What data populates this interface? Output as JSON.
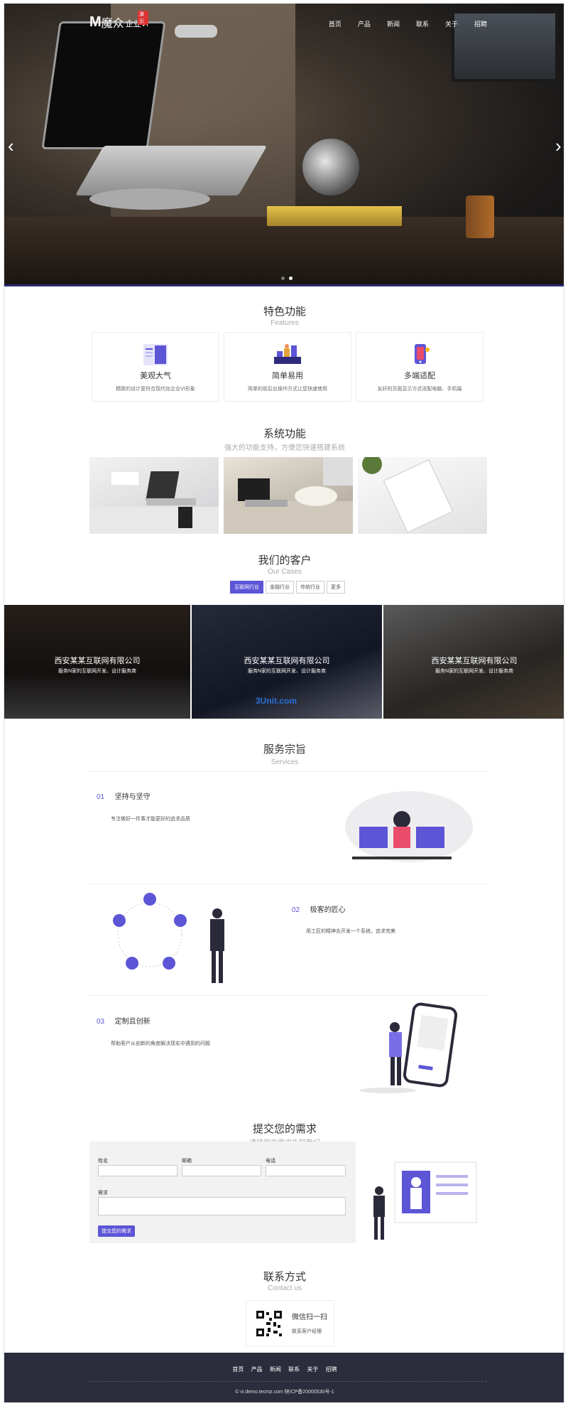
{
  "header": {
    "logo_mark": "M",
    "logo_text": "魔众",
    "logo_sub": "企业VI",
    "logo_badge": "演示",
    "nav": [
      "首页",
      "产品",
      "新闻",
      "联系",
      "关于",
      "招聘"
    ]
  },
  "features": {
    "title": "特色功能",
    "subtitle": "Features",
    "items": [
      {
        "title": "美观大气",
        "desc": "精致的设计更符合现代化企业VI形象"
      },
      {
        "title": "简单易用",
        "desc": "简单的前后台操作方式让您快速使用"
      },
      {
        "title": "多端适配",
        "desc": "友好的页面显示方式适配电脑、手机端"
      }
    ]
  },
  "system": {
    "title": "系统功能",
    "subtitle": "强大的功能支持，方便您快速搭建系统"
  },
  "clients": {
    "title": "我们的客户",
    "subtitle": "Our Cases",
    "tabs": [
      "互联网行业",
      "金融行业",
      "传统行业",
      "更多"
    ],
    "cases": [
      {
        "title": "西安某某互联网有限公司",
        "desc": "服务N家的互联网开发、设计服务商"
      },
      {
        "title": "西安某某互联网有限公司",
        "desc": "服务N家的互联网开发、设计服务商"
      },
      {
        "title": "西安某某互联网有限公司",
        "desc": "服务N家的互联网开发、设计服务商"
      }
    ],
    "watermark": "3Unit.com"
  },
  "services": {
    "title": "服务宗旨",
    "subtitle": "Services",
    "items": [
      {
        "num": "01",
        "title": "坚持与坚守",
        "desc": "专注做好一件事才能更好的追求品质"
      },
      {
        "num": "02",
        "title": "极客的匠心",
        "desc": "用工匠的精神去开发一个系统，追求完美"
      },
      {
        "num": "03",
        "title": "定制且创新",
        "desc": "帮助客户从创新的角度解决现实中遇到的问题"
      }
    ]
  },
  "request": {
    "title": "提交您的需求",
    "subtitle": "请将您的需求告知我们",
    "name_label": "姓名",
    "email_label": "邮箱",
    "phone_label": "电话",
    "need_label": "需求",
    "submit_label": "提交您的需求"
  },
  "contact": {
    "title": "联系方式",
    "subtitle": "Contact us",
    "qr_title": "微信扫一扫",
    "qr_desc": "联系客户经理"
  },
  "footer": {
    "nav": [
      "首页",
      "产品",
      "新闻",
      "联系",
      "关于",
      "招聘"
    ],
    "copyright": "© vi.demo.tecmz.com 陕ICP备20000530号-1"
  },
  "colors": {
    "accent": "#5c55d6",
    "footer": "#2b2d3c"
  }
}
